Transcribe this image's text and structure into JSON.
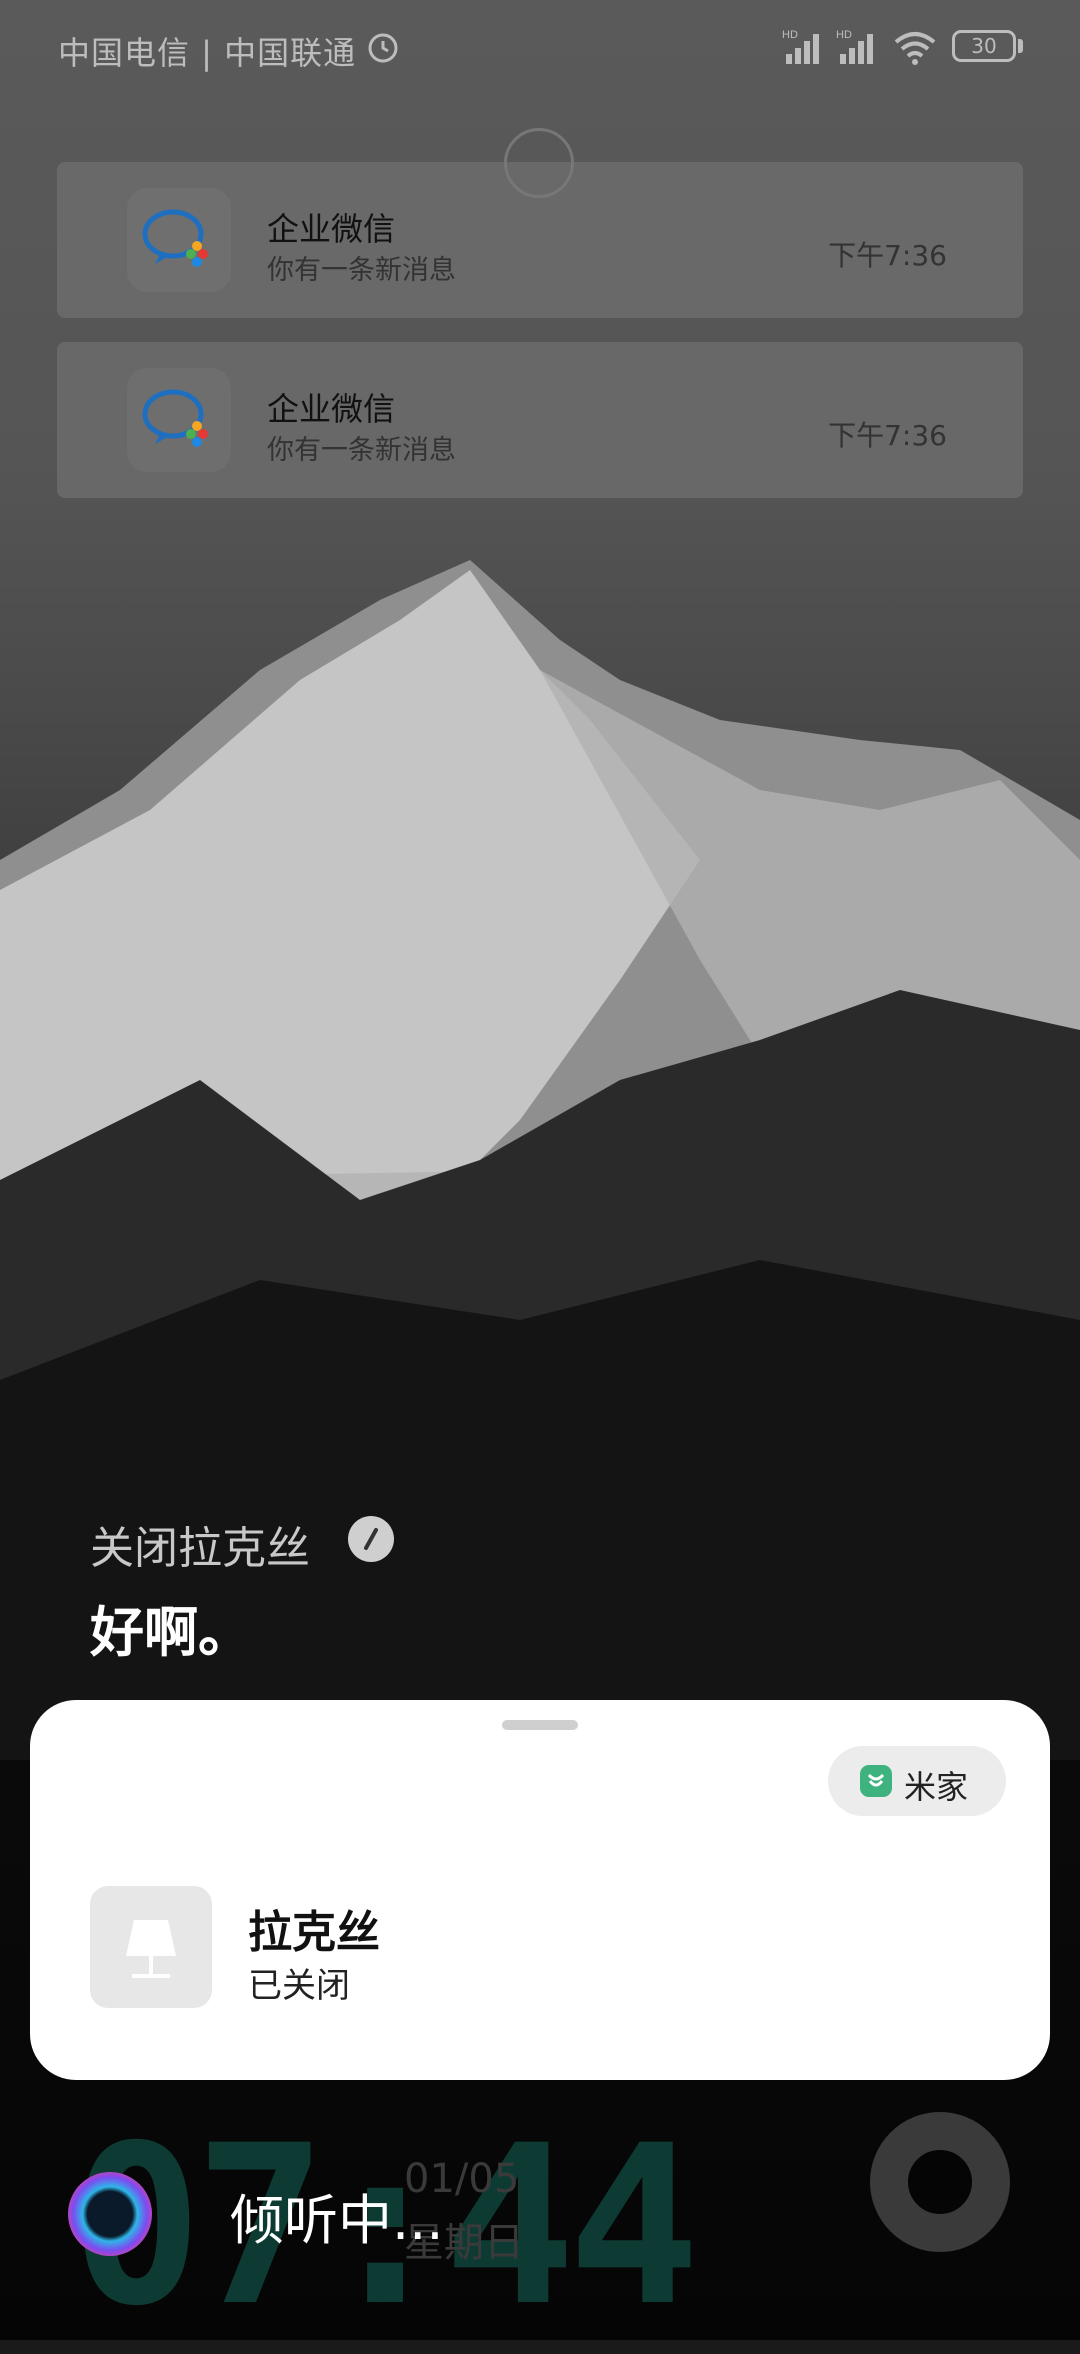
{
  "status_bar": {
    "carrier": "中国电信 | 中国联通",
    "battery": "30"
  },
  "notifications": [
    {
      "app": "企业微信",
      "message": "你有一条新消息",
      "time": "下午7:36"
    },
    {
      "app": "企业微信",
      "message": "你有一条新消息",
      "time": "下午7:36"
    }
  ],
  "assistant": {
    "command": "关闭拉克丝",
    "reply": "好啊。",
    "listening": "倾听中..."
  },
  "card": {
    "source_label": "米家",
    "device_name": "拉克丝",
    "device_status": "已关闭"
  },
  "lockscreen": {
    "clock": "07:44",
    "date": "01/05",
    "weekday": "星期日"
  }
}
